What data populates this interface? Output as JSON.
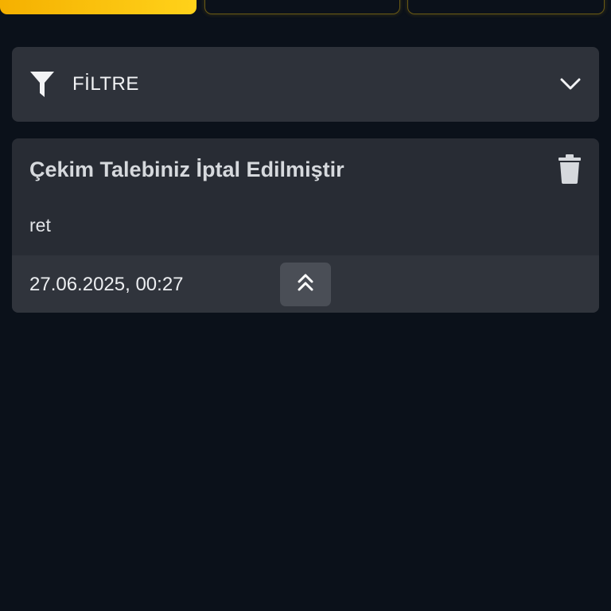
{
  "tabs": [
    {
      "label": "",
      "active": true
    },
    {
      "label": "",
      "active": false
    },
    {
      "label": "",
      "active": false
    }
  ],
  "filter": {
    "label": "FİLTRE",
    "icon": "filter-icon",
    "toggle_icon": "chevron-down-icon"
  },
  "notification": {
    "title": "Çekim Talebiniz İptal Edilmiştir",
    "message": "ret",
    "timestamp": "27.06.2025, 00:27",
    "delete_icon": "trash-icon",
    "expand_icon": "double-chevron-up-icon"
  },
  "colors": {
    "accent": "#ffc107",
    "background": "#0b111a",
    "panel": "#2e323a"
  }
}
